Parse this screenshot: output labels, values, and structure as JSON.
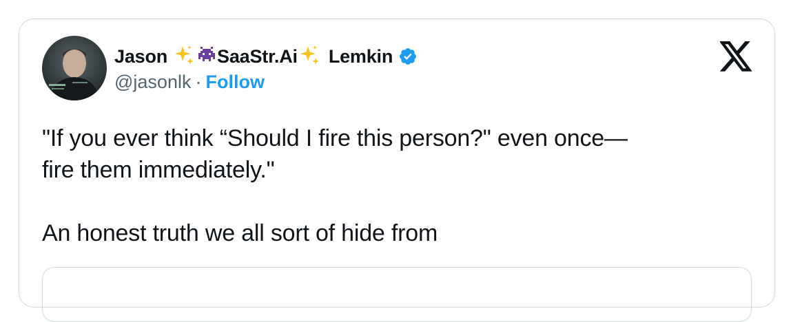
{
  "tweet": {
    "author": {
      "name_first": "Jason",
      "name_brand": "SaaStr.Ai",
      "name_last": "Lemkin",
      "handle": "@jasonlk",
      "separator": "·",
      "follow_label": "Follow",
      "verified": true,
      "icons": [
        "sparkles-icon",
        "alien-monster-icon",
        "sparkles-icon",
        "verified-badge-icon"
      ]
    },
    "platform_icon": "x-logo-icon",
    "text_lines": [
      "\"If you ever think “Should I fire this person?\" even once—",
      "fire them immediately.\""
    ],
    "text_second_paragraph": "An honest truth we all sort of hide from"
  },
  "colors": {
    "text": "#0f1419",
    "secondary": "#536471",
    "accent": "#1d9bf0",
    "border": "#cfd9de",
    "sparkle": "#f7c31b",
    "alien": "#6b3fa0"
  }
}
